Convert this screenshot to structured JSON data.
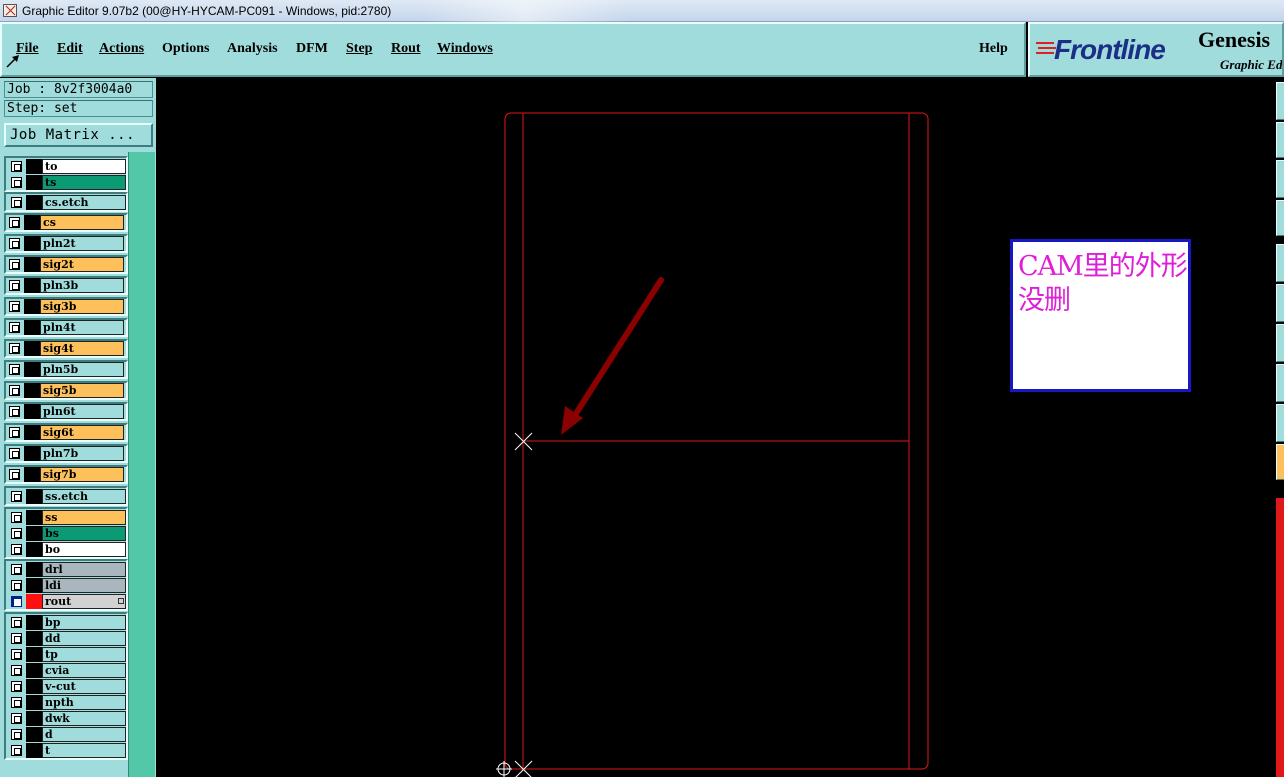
{
  "window": {
    "title": "Graphic Editor 9.07b2 (00@HY-HYCAM-PC091 - Windows, pid:2780)"
  },
  "menu": {
    "items": [
      "File",
      "Edit",
      "Actions",
      "Options",
      "Analysis",
      "DFM",
      "Step",
      "Rout",
      "Windows"
    ],
    "help": "Help"
  },
  "logo": {
    "brand": "Frontline",
    "product": "Genesis",
    "subtitle": "Graphic Ed"
  },
  "job_info": {
    "job": "Job : 8v2f3004a0",
    "step": "Step: set",
    "matrix_button": "Job Matrix ..."
  },
  "layers": [
    {
      "name": "to",
      "color": "#ffffff"
    },
    {
      "name": "ts",
      "color": "#0b9a73"
    },
    {
      "name": "cs.etch",
      "color": "#a0dcdc"
    },
    {
      "name": "cs",
      "color": "#fdc05a"
    },
    {
      "name": "pln2t",
      "color": "#a0dcdc"
    },
    {
      "name": "sig2t",
      "color": "#fdc05a"
    },
    {
      "name": "pln3b",
      "color": "#a0dcdc"
    },
    {
      "name": "sig3b",
      "color": "#fdc05a"
    },
    {
      "name": "pln4t",
      "color": "#a0dcdc"
    },
    {
      "name": "sig4t",
      "color": "#fdc05a"
    },
    {
      "name": "pln5b",
      "color": "#a0dcdc"
    },
    {
      "name": "sig5b",
      "color": "#fdc05a"
    },
    {
      "name": "pln6t",
      "color": "#a0dcdc"
    },
    {
      "name": "sig6t",
      "color": "#fdc05a"
    },
    {
      "name": "pln7b",
      "color": "#a0dcdc"
    },
    {
      "name": "sig7b",
      "color": "#fdc05a"
    },
    {
      "name": "ss.etch",
      "color": "#a0dcdc"
    },
    {
      "name": "ss",
      "color": "#fdc05a"
    },
    {
      "name": "bs",
      "color": "#0b9a73"
    },
    {
      "name": "bo",
      "color": "#ffffff"
    },
    {
      "name": "drl",
      "color": "#a7b7bd"
    },
    {
      "name": "ldi",
      "color": "#a7b7bd"
    },
    {
      "name": "rout",
      "color": "#d2d2d2",
      "active": true,
      "swatch": "#ff1010"
    },
    {
      "name": "bp",
      "color": "#a0dcdc"
    },
    {
      "name": "dd",
      "color": "#a0dcdc"
    },
    {
      "name": "tp",
      "color": "#a0dcdc"
    },
    {
      "name": "cvia",
      "color": "#a0dcdc"
    },
    {
      "name": "v-cut",
      "color": "#a0dcdc"
    },
    {
      "name": "npth",
      "color": "#a0dcdc"
    },
    {
      "name": "dwk",
      "color": "#a0dcdc"
    },
    {
      "name": "d",
      "color": "#a0dcdc"
    },
    {
      "name": "t",
      "color": "#a0dcdc"
    }
  ],
  "annotation": {
    "text": "CAM里的外形没删",
    "color": "#e01ed8",
    "border": "#1717c4"
  },
  "colors": {
    "panel": "#a0dcdc",
    "outline": "#e01818",
    "arrow": "#8b0000"
  }
}
